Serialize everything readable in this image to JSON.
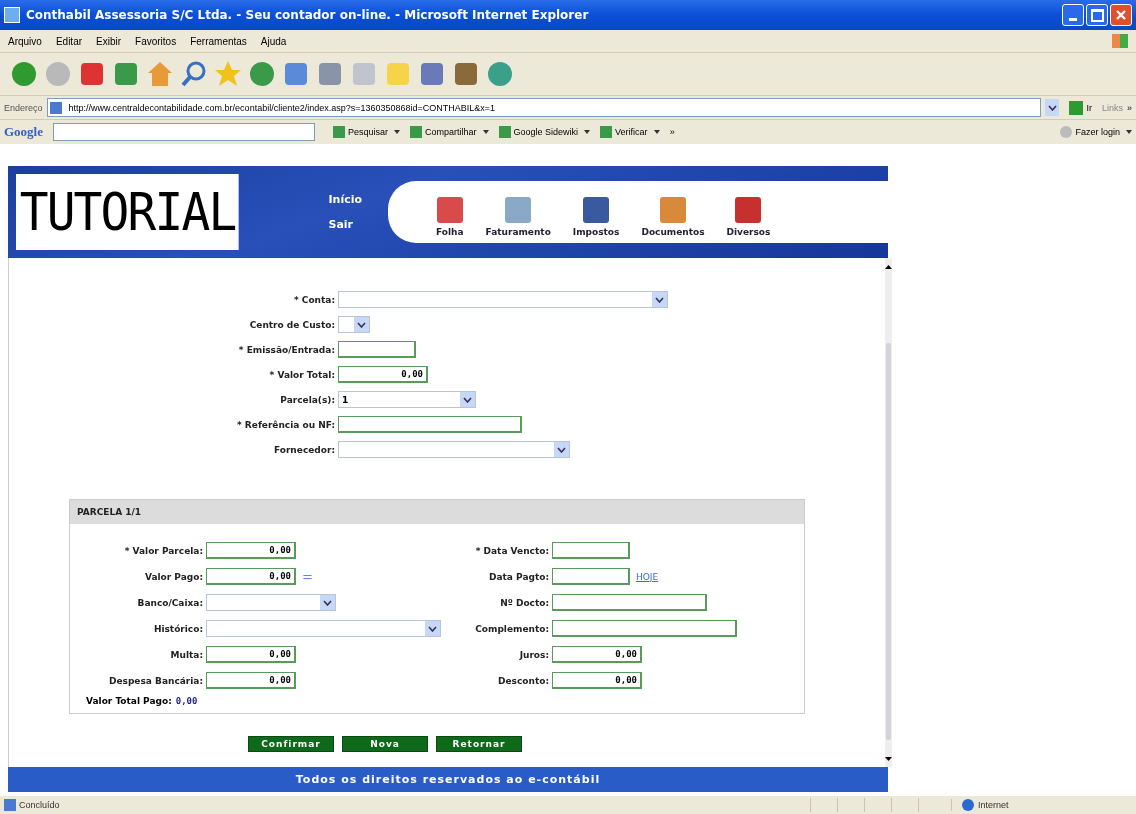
{
  "window": {
    "title": "Conthabil Assessoria S/C Ltda. - Seu contador on-line. - Microsoft Internet Explorer"
  },
  "menu": [
    "Arquivo",
    "Editar",
    "Exibir",
    "Favoritos",
    "Ferramentas",
    "Ajuda"
  ],
  "address_bar": {
    "label": "Endereço",
    "url": "http://www.centraldecontabilidade.com.br/econtabil/cliente2/index.asp?s=1360350868id=CONTHABIL&x=1",
    "go": "Ir",
    "links": "Links",
    "more": "»"
  },
  "google_bar": {
    "logo": "Google",
    "items": [
      {
        "label": "Pesquisar"
      },
      {
        "label": "Compartilhar"
      },
      {
        "label": "Google Sidewiki"
      },
      {
        "label": "Verificar"
      }
    ],
    "more": "»",
    "login": "Fazer login"
  },
  "header": {
    "logo": "TUTORIAL",
    "links": [
      "Início",
      "Sair"
    ],
    "nav": [
      "Folha",
      "Faturamento",
      "Impostos",
      "Documentos",
      "Diversos"
    ]
  },
  "main_form": {
    "fields": [
      {
        "label": "* Conta:",
        "kind": "select"
      },
      {
        "label": "Centro de Custo:",
        "kind": "select"
      },
      {
        "label": "* Emissão/Entrada:",
        "kind": "text"
      },
      {
        "label": "* Valor Total:",
        "kind": "amount",
        "value": "0,00"
      },
      {
        "label": "Parcela(s):",
        "kind": "select",
        "value": "1"
      },
      {
        "label": "* Referência ou NF:",
        "kind": "text"
      },
      {
        "label": "Fornecedor:",
        "kind": "select"
      }
    ]
  },
  "parcela": {
    "title": "PARCELA 1/1",
    "rows": [
      {
        "left": {
          "label": "* Valor Parcela:",
          "kind": "amount",
          "value": "0,00"
        },
        "right": {
          "label": "* Data Vencto:",
          "kind": "text"
        }
      },
      {
        "left": {
          "label": "Valor Pago:",
          "kind": "amount",
          "value": "0,00",
          "extra": "="
        },
        "right": {
          "label": "Data Pagto:",
          "kind": "text",
          "link": "HOJE"
        }
      },
      {
        "left": {
          "label": "Banco/Caixa:",
          "kind": "select"
        },
        "right": {
          "label": "Nº Docto:",
          "kind": "text"
        }
      },
      {
        "left": {
          "label": "Histórico:",
          "kind": "select"
        },
        "right": {
          "label": "Complemento:",
          "kind": "text"
        }
      },
      {
        "left": {
          "label": "Multa:",
          "kind": "amount",
          "value": "0,00"
        },
        "right": {
          "label": "Juros:",
          "kind": "amount",
          "value": "0,00"
        }
      },
      {
        "left": {
          "label": "Despesa Bancária:",
          "kind": "amount",
          "value": "0,00"
        },
        "right": {
          "label": "Desconto:",
          "kind": "amount",
          "value": "0,00"
        }
      }
    ],
    "total": {
      "label": "Valor Total Pago:",
      "value": "0,00"
    }
  },
  "buttons": [
    "Confirmar",
    "Nova",
    "Retornar"
  ],
  "footer": "Todos os direitos reservados ao e-contábil",
  "status_bar": {
    "text": "Concluído",
    "zone": "Internet"
  }
}
